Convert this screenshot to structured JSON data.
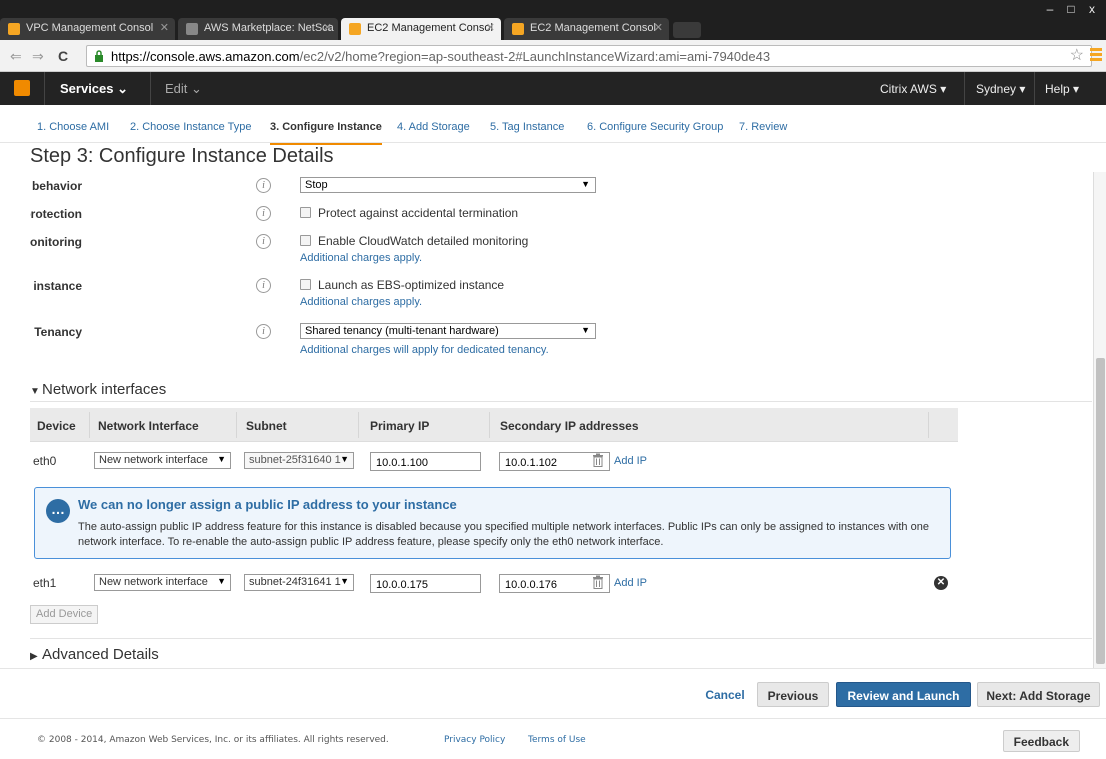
{
  "browser": {
    "tabs": [
      {
        "title": "VPC Management Consol",
        "favicon_color": "#f5a623"
      },
      {
        "title": "AWS Marketplace: NetSca",
        "favicon_color": "#888888"
      },
      {
        "title": "EC2 Management Consol",
        "favicon_color": "#f5a623"
      },
      {
        "title": "EC2 Management Consol",
        "favicon_color": "#f5a623"
      }
    ],
    "url_host": "https://console.aws.amazon.com",
    "url_rest": "/ec2/v2/home?region=ap-southeast-2#LaunchInstanceWizard:ami=ami-7940de43",
    "window_min": "–",
    "window_max": "□",
    "window_close": "x"
  },
  "aws_nav": {
    "services": "Services",
    "edit": "Edit",
    "account": "Citrix AWS",
    "region": "Sydney",
    "help": "Help"
  },
  "wizard_steps": [
    "1. Choose AMI",
    "2. Choose Instance Type",
    "3. Configure Instance",
    "4. Add Storage",
    "5. Tag Instance",
    "6. Configure Security Group",
    "7. Review"
  ],
  "page_title": "Step 3: Configure Instance Details",
  "form": {
    "shutdown": {
      "label": "Shutdown behavior",
      "value": "Stop"
    },
    "termination": {
      "label": "Enable termination protection",
      "checkbox": "Protect against accidental termination"
    },
    "monitoring": {
      "label": "Monitoring",
      "checkbox": "Enable CloudWatch detailed monitoring",
      "note": "Additional charges apply."
    },
    "ebs": {
      "label": "EBS-optimized instance",
      "checkbox": "Launch as EBS-optimized instance",
      "note": "Additional charges apply."
    },
    "tenancy": {
      "label": "Tenancy",
      "value": "Shared tenancy (multi-tenant hardware)",
      "note": "Additional charges will apply for dedicated tenancy."
    }
  },
  "network": {
    "section_title": "Network interfaces",
    "columns": [
      "Device",
      "Network Interface",
      "Subnet",
      "Primary IP",
      "Secondary IP addresses"
    ],
    "rows": [
      {
        "device": "eth0",
        "interface": "New network interface",
        "subnet": "subnet-25f31640 1",
        "primary_ip": "10.0.1.100",
        "secondary_ip": "10.0.1.102",
        "add_ip": "Add IP"
      },
      {
        "device": "eth1",
        "interface": "New network interface",
        "subnet": "subnet-24f31641 1",
        "primary_ip": "10.0.0.175",
        "secondary_ip": "10.0.0.176",
        "add_ip": "Add IP"
      }
    ],
    "notice_title": "We can no longer assign a public IP address to your instance",
    "notice_body": "The auto-assign public IP address feature for this instance is disabled because you specified multiple network interfaces. Public IPs can only be assigned to instances with one network interface. To re-enable the auto-assign public IP address feature, please specify only the eth0 network interface.",
    "add_device": "Add Device"
  },
  "advanced_title": "Advanced Details",
  "buttons": {
    "cancel": "Cancel",
    "previous": "Previous",
    "review": "Review and Launch",
    "next": "Next: Add Storage"
  },
  "footer": {
    "copyright": "© 2008 - 2014, Amazon Web Services, Inc. or its affiliates. All rights reserved.",
    "privacy": "Privacy Policy",
    "terms": "Terms of Use",
    "feedback": "Feedback"
  },
  "colors": {
    "aws_orange": "#f08a00",
    "link_blue": "#2e6da4",
    "header_dark": "#232323"
  }
}
